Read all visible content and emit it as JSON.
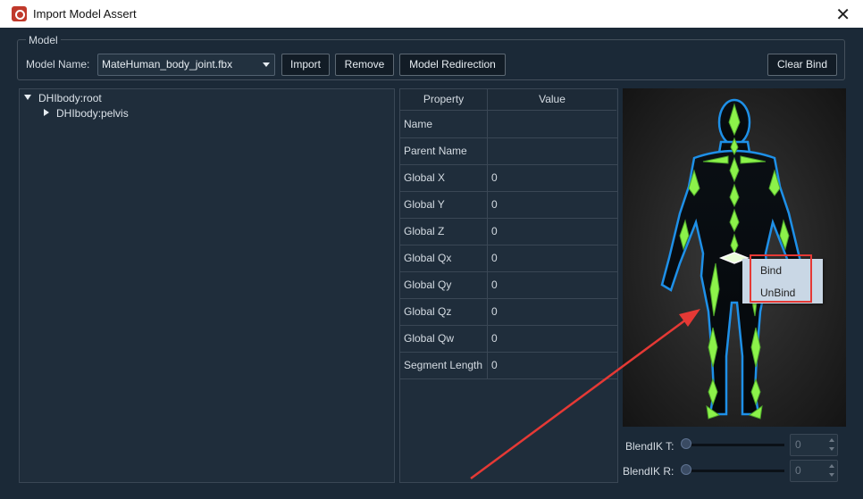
{
  "window": {
    "title": "Import Model Assert"
  },
  "model_group": {
    "title": "Model",
    "model_name_label": "Model Name:",
    "model_name_value": "MateHuman_body_joint.fbx",
    "buttons": {
      "import": "Import",
      "remove": "Remove",
      "redirect": "Model Redirection",
      "clear_bind": "Clear Bind"
    }
  },
  "tree": {
    "items": [
      {
        "label": "DHIbody:root"
      },
      {
        "label": "DHIbody:pelvis"
      }
    ]
  },
  "properties": {
    "headers": {
      "property": "Property",
      "value": "Value"
    },
    "rows": [
      {
        "name": "Name",
        "value": ""
      },
      {
        "name": "Parent Name",
        "value": ""
      },
      {
        "name": "Global X",
        "value": "0"
      },
      {
        "name": "Global Y",
        "value": "0"
      },
      {
        "name": "Global Z",
        "value": "0"
      },
      {
        "name": "Global Qx",
        "value": "0"
      },
      {
        "name": "Global Qy",
        "value": "0"
      },
      {
        "name": "Global Qz",
        "value": "0"
      },
      {
        "name": "Global Qw",
        "value": "0"
      },
      {
        "name": "Segment Length",
        "value": "0"
      }
    ]
  },
  "context_menu": {
    "bind": "Bind",
    "unbind": "UnBind"
  },
  "blend": {
    "t_label": "BlendIK T:",
    "t_value": "0",
    "t_slider": 0,
    "r_label": "BlendIK R:",
    "r_value": "0",
    "r_slider": 0
  },
  "colors": {
    "bone_green": "#8cf24a",
    "outline_blue": "#1e90e8",
    "annotation_red": "#e53935"
  }
}
